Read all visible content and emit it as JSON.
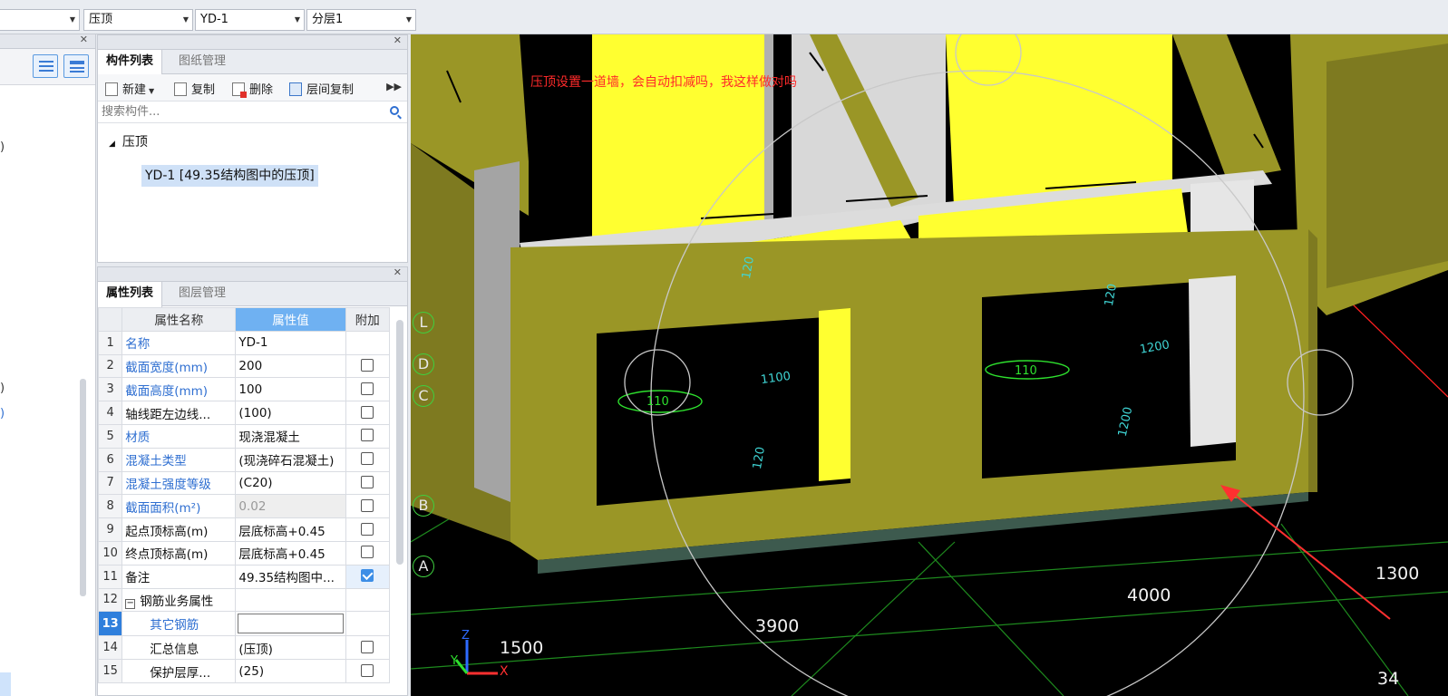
{
  "toolbar": {
    "combo0": "",
    "combo1": "压顶",
    "combo2": "YD-1",
    "combo3": "分层1"
  },
  "left_partial": {
    "frag1": ")",
    "frag2": ")",
    "frag3": ")"
  },
  "component_panel": {
    "tabs": [
      "构件列表",
      "图纸管理"
    ],
    "actions": [
      "新建",
      "复制",
      "删除",
      "层间复制"
    ],
    "search_placeholder": "搜索构件...",
    "tree_root": "压顶",
    "tree_leaf": "YD-1 [49.35结构图中的压顶]"
  },
  "property_panel": {
    "tabs": [
      "属性列表",
      "图层管理"
    ],
    "headers": [
      "属性名称",
      "属性值",
      "附加"
    ],
    "rows": [
      {
        "n": "1",
        "name": "名称",
        "value": "YD-1"
      },
      {
        "n": "2",
        "name": "截面宽度(mm)",
        "value": "200"
      },
      {
        "n": "3",
        "name": "截面高度(mm)",
        "value": "100"
      },
      {
        "n": "4",
        "name": "轴线距左边线...",
        "value": "(100)"
      },
      {
        "n": "5",
        "name": "材质",
        "value": "现浇混凝土"
      },
      {
        "n": "6",
        "name": "混凝土类型",
        "value": "(现浇碎石混凝土)"
      },
      {
        "n": "7",
        "name": "混凝土强度等级",
        "value": "(C20)"
      },
      {
        "n": "8",
        "name": "截面面积(m²)",
        "value": "0.02"
      },
      {
        "n": "9",
        "name": "起点顶标高(m)",
        "value": "层底标高+0.45"
      },
      {
        "n": "10",
        "name": "终点顶标高(m)",
        "value": "层底标高+0.45"
      },
      {
        "n": "11",
        "name": "备注",
        "value": "49.35结构图中..."
      },
      {
        "n": "12",
        "name": "钢筋业务属性",
        "value": ""
      },
      {
        "n": "13",
        "name": "其它钢筋",
        "value": ""
      },
      {
        "n": "14",
        "name": "汇总信息",
        "value": "(压顶)"
      },
      {
        "n": "15",
        "name": "保护层厚...",
        "value": "(25)"
      }
    ]
  },
  "viewport": {
    "annotation": "压顶设置一道墙，会自动扣减吗，我这样做对吗",
    "axis_labels": [
      "L",
      "D",
      "C",
      "B",
      "A"
    ],
    "dims": {
      "d1500": "1500",
      "d3900": "3900",
      "d4000": "4000",
      "d1300": "1300",
      "d34": "34"
    },
    "plan_labels": {
      "p110a": "110",
      "p110b": "110",
      "p1100": "1100",
      "p1200": "1200",
      "p1200v": "1200",
      "p120a": "120",
      "p120b": "120",
      "p120c": "120"
    },
    "gizmo": {
      "x": "X",
      "y": "Y",
      "z": "Z"
    },
    "colors": {
      "wall_yellow": "#ffff30",
      "coping_olive": "#9a9626",
      "grid_red": "#ff2020",
      "grid_green": "#1e8a1e"
    }
  }
}
